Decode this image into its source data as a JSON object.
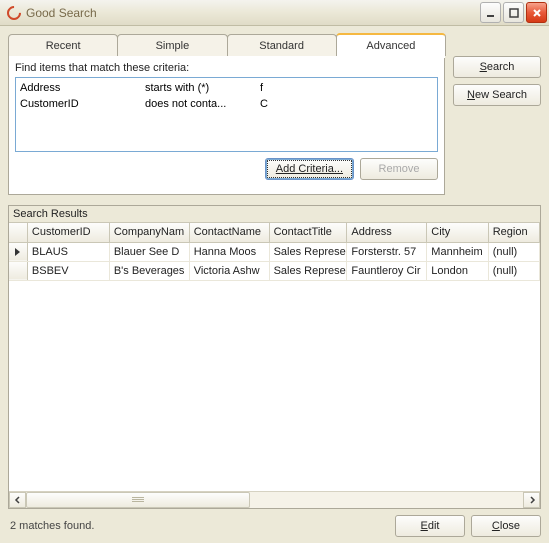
{
  "window": {
    "title": "Good Search"
  },
  "tabs": [
    "Recent",
    "Simple",
    "Standard",
    "Advanced"
  ],
  "active_tab_index": 3,
  "criteria": {
    "label": "Find items that match these criteria:",
    "rows": [
      {
        "field": "Address",
        "condition": "starts with (*)",
        "value": "f"
      },
      {
        "field": "CustomerID",
        "condition": "does not conta...",
        "value": "C"
      }
    ],
    "add_button": "Add Criteria...",
    "remove_button": "Remove"
  },
  "side": {
    "search": "Search",
    "new_search": "New Search",
    "search_ul": "S",
    "new_search_prefix": "N",
    "new_search_rest": "ew Search"
  },
  "results": {
    "title": "Search Results",
    "columns": [
      "CustomerID",
      "CompanyNam",
      "ContactName",
      "ContactTitle",
      "Address",
      "City",
      "Region"
    ],
    "rows": [
      {
        "cells": [
          "BLAUS",
          "Blauer See D",
          "Hanna Moos",
          "Sales Represe",
          "Forsterstr. 57",
          "Mannheim",
          "(null)"
        ],
        "current": true
      },
      {
        "cells": [
          "BSBEV",
          "B's Beverages",
          "Victoria Ashw",
          "Sales Represe",
          "Fauntleroy Cir",
          "London",
          "(null)"
        ],
        "current": false
      }
    ]
  },
  "status": {
    "text": "2 matches found.",
    "edit_prefix": "E",
    "edit_rest": "dit",
    "close_prefix": "C",
    "close_rest": "lose"
  }
}
